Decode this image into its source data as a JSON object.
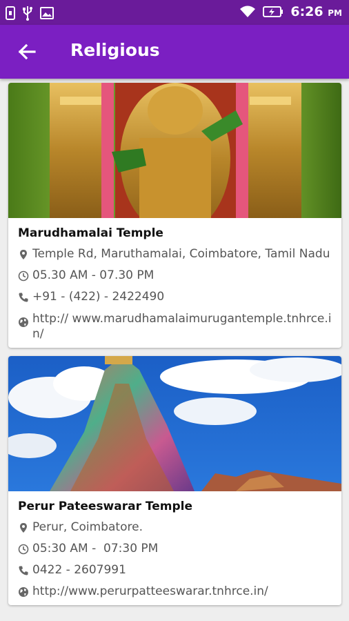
{
  "status_bar": {
    "time": "6:26",
    "ampm": "PM",
    "icons": [
      "sim-icon",
      "usb-icon",
      "image-icon",
      "wifi-icon",
      "battery-charging-icon"
    ]
  },
  "app_bar": {
    "title": "Religious",
    "back_icon": "arrow-left-icon"
  },
  "temples": [
    {
      "name": "Marudhamalai Temple",
      "address": "Temple Rd, Maruthamalai, Coimbatore, Tamil Nadu",
      "hours": "05.30 AM - 07.30 PM",
      "phone": "+91 - (422) - 2422490",
      "website": "http:// www.marudhamalaimurugantemple.tnhrce.in/"
    },
    {
      "name": "Perur Pateeswarar Temple",
      "address": "Perur, Coimbatore.",
      "hours": "05:30 AM -  07:30 PM",
      "phone": "0422 - 2607991",
      "website": "http://www.perurpatteeswarar.tnhrce.in/"
    }
  ],
  "colors": {
    "status_bar": "#6a1b9a",
    "app_bar": "#7b1fc2",
    "background": "#eeeeee"
  }
}
